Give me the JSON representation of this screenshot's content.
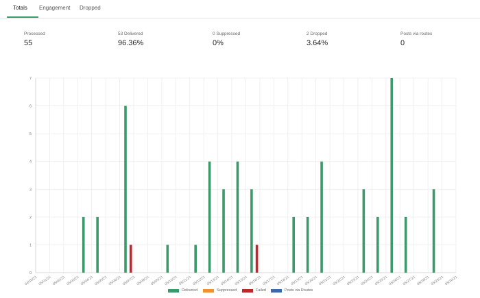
{
  "tabs": [
    {
      "label": "Totals",
      "active": true
    },
    {
      "label": "Engagement",
      "active": false
    },
    {
      "label": "Dropped",
      "active": false
    }
  ],
  "stats": [
    {
      "label": "Processed",
      "value": "55"
    },
    {
      "label": "53 Delivered",
      "value": "96.36%"
    },
    {
      "label": "0 Suppressed",
      "value": "0%"
    },
    {
      "label": "2 Dropped",
      "value": "3.64%"
    },
    {
      "label": "Posts via routes",
      "value": "0"
    }
  ],
  "chart_data": {
    "type": "bar",
    "categories": [
      "04/30/21",
      "05/01/21",
      "05/02/21",
      "05/03/21",
      "05/04/21",
      "05/05/21",
      "05/06/21",
      "05/07/21",
      "05/08/21",
      "05/09/21",
      "05/10/21",
      "05/11/21",
      "05/12/21",
      "05/13/21",
      "05/14/21",
      "05/15/21",
      "05/16/21",
      "05/17/21",
      "05/18/21",
      "05/19/21",
      "05/20/21",
      "05/21/21",
      "05/22/21",
      "05/23/21",
      "05/24/21",
      "05/25/21",
      "05/26/21",
      "05/27/21",
      "05/28/21",
      "05/29/21",
      "05/30/21"
    ],
    "series": [
      {
        "name": "Delivered",
        "color": "#3a9a6a",
        "values": [
          0,
          0,
          0,
          2,
          2,
          0,
          6,
          0,
          0,
          1,
          0,
          1,
          4,
          3,
          4,
          3,
          0,
          0,
          2,
          2,
          4,
          0,
          0,
          3,
          2,
          7,
          2,
          0,
          3,
          0,
          0
        ]
      },
      {
        "name": "Suppressed",
        "color": "#f0922b",
        "values": [
          0,
          0,
          0,
          0,
          0,
          0,
          0,
          0,
          0,
          0,
          0,
          0,
          0,
          0,
          0,
          0,
          0,
          0,
          0,
          0,
          0,
          0,
          0,
          0,
          0,
          0,
          0,
          0,
          0,
          0,
          0
        ]
      },
      {
        "name": "Failed",
        "color": "#c0272d",
        "values": [
          0,
          0,
          0,
          0,
          0,
          0,
          1,
          0,
          0,
          0,
          0,
          0,
          0,
          0,
          0,
          1,
          0,
          0,
          0,
          0,
          0,
          0,
          0,
          0,
          0,
          0,
          0,
          0,
          0,
          0,
          0
        ]
      },
      {
        "name": "Posts via Routes",
        "color": "#3f66b3",
        "values": [
          0,
          0,
          0,
          0,
          0,
          0,
          0,
          0,
          0,
          0,
          0,
          0,
          0,
          0,
          0,
          0,
          0,
          0,
          0,
          0,
          0,
          0,
          0,
          0,
          0,
          0,
          0,
          0,
          0,
          0,
          0
        ]
      }
    ],
    "ylim": [
      0,
      7
    ],
    "yticks": [
      "0",
      "1",
      "2",
      "3",
      "4",
      "5",
      "6",
      "7"
    ],
    "grid": true,
    "legend_position": "bottom-center"
  }
}
